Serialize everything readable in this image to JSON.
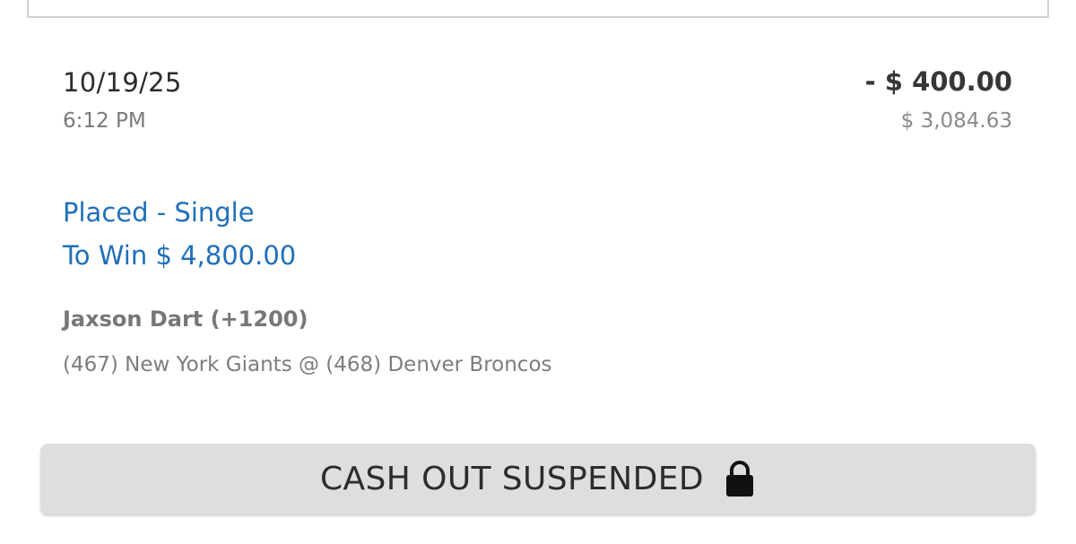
{
  "bet": {
    "date": "10/19/25",
    "time": "6:12 PM",
    "amount": "- $ 400.00",
    "balance": "$ 3,084.63",
    "status": "Placed - Single",
    "to_win": "To Win $ 4,800.00",
    "selection": "Jaxson Dart (+1200)",
    "matchup": "(467) New York Giants @ (468) Denver Broncos"
  },
  "cashout": {
    "label": "CASH OUT SUSPENDED",
    "icon": "lock-icon"
  },
  "colors": {
    "status_blue": "#1f6fba",
    "button_bg": "#dedede"
  }
}
